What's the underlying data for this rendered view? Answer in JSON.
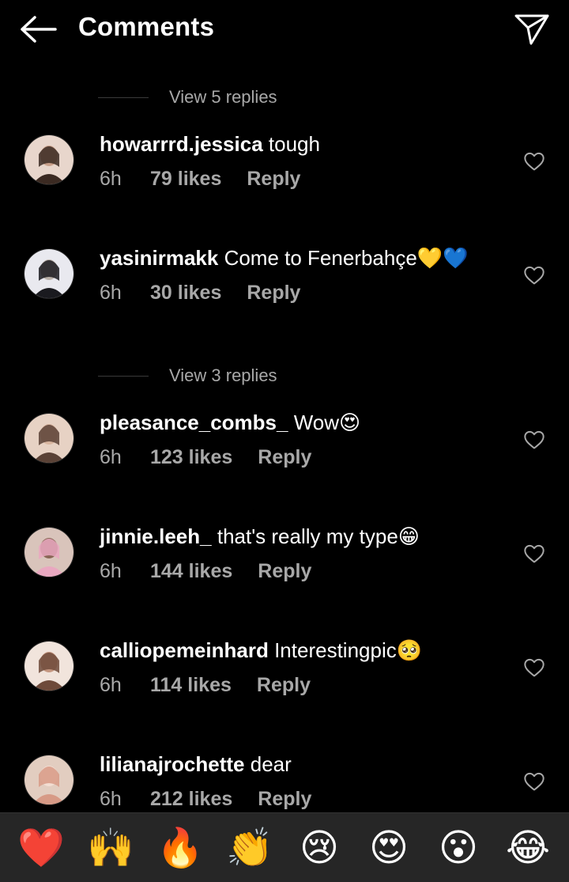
{
  "header": {
    "title": "Comments",
    "back_icon": "back-arrow-icon",
    "send_icon": "send-icon"
  },
  "comments_list": [
    {
      "type": "view_replies",
      "label": "View 5 replies"
    },
    {
      "type": "comment",
      "username": "howarrrd.jessica",
      "text": "tough",
      "emoji": "",
      "time": "6h",
      "likes": "79 likes",
      "reply": "Reply"
    },
    {
      "type": "comment",
      "username": "yasinirmakk",
      "text": "Come to Fenerbahçe",
      "emoji": "💛💙",
      "time": "6h",
      "likes": "30 likes",
      "reply": "Reply"
    },
    {
      "type": "view_replies",
      "label": "View 3 replies"
    },
    {
      "type": "comment",
      "username": "pleasance_combs_",
      "text": "Wow",
      "emoji": "😍",
      "time": "6h",
      "likes": "123 likes",
      "reply": "Reply"
    },
    {
      "type": "comment",
      "username": "jinnie.leeh_",
      "text": "that's really my type",
      "emoji": "😁",
      "time": "6h",
      "likes": "144 likes",
      "reply": "Reply"
    },
    {
      "type": "comment",
      "username": "calliopemeinhard",
      "text": "Interestingpic",
      "emoji": "🥺",
      "time": "6h",
      "likes": "114 likes",
      "reply": "Reply"
    },
    {
      "type": "comment",
      "username": "lilianajrochette",
      "text": "dear",
      "emoji": "",
      "time": "6h",
      "likes": "212 likes",
      "reply": "Reply"
    }
  ],
  "reactions": [
    {
      "emoji": "❤️",
      "name": "red-heart"
    },
    {
      "emoji": "🙌",
      "name": "raising-hands"
    },
    {
      "emoji": "🔥",
      "name": "fire"
    },
    {
      "emoji": "👏",
      "name": "clapping-hands"
    },
    {
      "emoji": "😢",
      "name": "sad-face"
    },
    {
      "emoji": "😍",
      "name": "heart-eyes"
    },
    {
      "emoji": "😮",
      "name": "surprised-face"
    },
    {
      "emoji": "😂",
      "name": "tears-of-joy"
    }
  ],
  "colors": {
    "background": "#000000",
    "text": "#ffffff",
    "secondary_text": "#a8a8a8",
    "reaction_bar": "#262626"
  }
}
